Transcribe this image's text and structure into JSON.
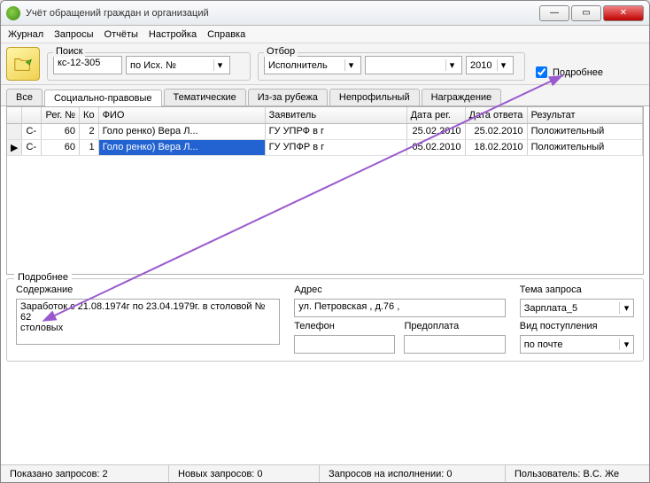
{
  "window": {
    "title": "Учёт обращений граждан и организаций"
  },
  "menu": {
    "items": [
      "Журнал",
      "Запросы",
      "Отчёты",
      "Настройка",
      "Справка"
    ]
  },
  "toolbar": {
    "search": {
      "legend": "Поиск",
      "value": "кс-12-305",
      "mode": "по Исх. №"
    },
    "filter": {
      "legend": "Отбор",
      "executor": "Исполнитель",
      "extra": "",
      "year": "2010"
    },
    "details_check": "Подробнее"
  },
  "tabs": [
    "Все",
    "Социально-правовые",
    "Тематические",
    "Из-за рубежа",
    "Непрофильный",
    "Награждение"
  ],
  "active_tab": 1,
  "grid": {
    "columns": [
      "",
      "",
      "Рег. №",
      "Ко",
      "ФИО",
      "Заявитель",
      "Дата рег.",
      "Дата ответа",
      "Результат"
    ],
    "rows": [
      {
        "sel": "",
        "cat": "С-",
        "reg": "60",
        "ko": "2",
        "fio": "Голо                    ренко) Вера Л...",
        "app": "ГУ УПРФ в г",
        "dreg": "25.02.2010",
        "dans": "25.02.2010",
        "res": "Положительный",
        "selected": false
      },
      {
        "sel": "▶",
        "cat": "С-",
        "reg": "60",
        "ko": "1",
        "fio": "Голо                    ренко) Вера Л...",
        "app": "ГУ УПФР в г",
        "dreg": "05.02.2010",
        "dans": "18.02.2010",
        "res": "Положительный",
        "selected": true
      }
    ]
  },
  "details": {
    "legend": "Подробнее",
    "content_label": "Содержание",
    "content": "Заработок с 21.08.1974г по 23.04.1979г. в столовой    № 62\nстоловых",
    "address_label": "Адрес",
    "address": "ул. Петровская , д.76 ,",
    "phone_label": "Телефон",
    "phone": "",
    "prepay_label": "Предоплата",
    "prepay": "",
    "subject_label": "Тема запроса",
    "subject": "Зарплата_5",
    "channel_label": "Вид поступления",
    "channel": "по почте"
  },
  "status": {
    "shown": "Показано запросов: 2",
    "new": "Новых запросов: 0",
    "exec": "Запросов на исполнении: 0",
    "user": "Пользователь: В.С. Же"
  }
}
